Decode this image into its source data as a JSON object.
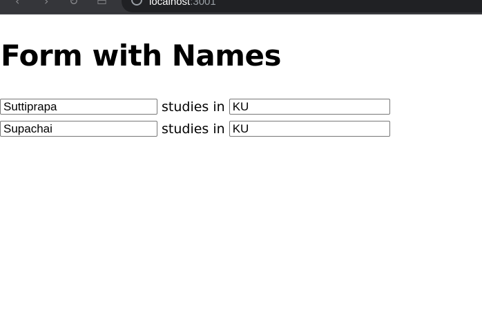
{
  "browser": {
    "url_host": "localhost",
    "url_port": ":3001"
  },
  "page": {
    "title": "Form with Names",
    "rows": [
      {
        "name": "Suttiprapa",
        "connector": "studies in",
        "university": "KU"
      },
      {
        "name": "Supachai",
        "connector": "studies in",
        "university": "KU"
      }
    ]
  }
}
